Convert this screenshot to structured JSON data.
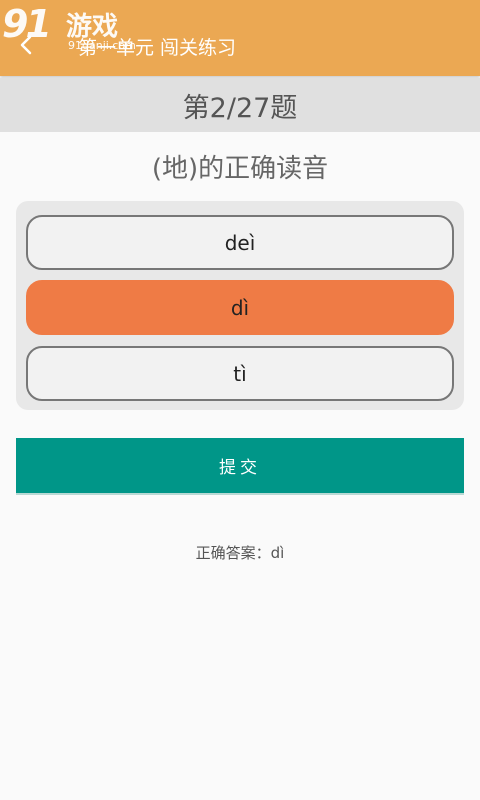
{
  "appbar": {
    "title": "第一单元  闯关练习",
    "back_icon": "back-arrow-icon",
    "color": "#eba853"
  },
  "watermark": {
    "logo": "91",
    "text": "游戏",
    "url": "91danji.com"
  },
  "quiz": {
    "progress": "第2/27题",
    "question": "(地)的正确读音",
    "options": [
      {
        "label": "deì",
        "selected": false
      },
      {
        "label": "dì",
        "selected": true
      },
      {
        "label": "tì",
        "selected": false
      }
    ],
    "selected_color": "#ef7b45"
  },
  "submit": {
    "label": "提交",
    "color": "#009688"
  },
  "answer": {
    "prefix": "正确答案：",
    "value": "dì"
  }
}
